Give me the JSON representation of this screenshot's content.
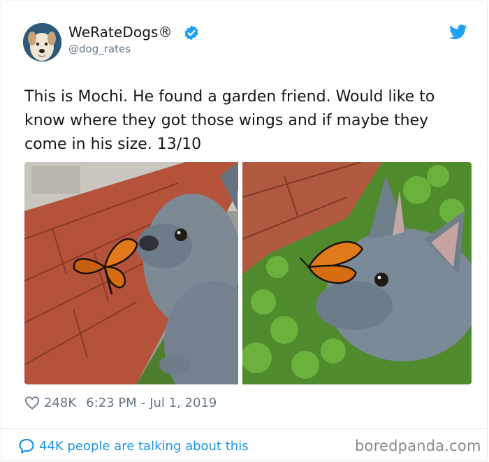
{
  "author": {
    "display_name": "WeRateDogs®",
    "handle": "@dog_rates",
    "verified": true
  },
  "tweet": {
    "text": "This is Mochi. He found a garden friend. Would like to know where they got those wings and if maybe they come in his size. 13/10",
    "likes": "248K",
    "time": "6:23 PM",
    "date_separator": "-",
    "date": "Jul 1, 2019"
  },
  "footer": {
    "talking_text": "44K people are talking about this",
    "watermark": "boredpanda.com"
  },
  "colors": {
    "link_blue": "#1b95e0",
    "verified_blue": "#1da1f2",
    "muted_gray": "#657786",
    "border": "#e1e8ed"
  },
  "icons": {
    "verified": "verified-badge-icon",
    "brand": "twitter-bird-icon",
    "like": "heart-icon",
    "reply": "speech-bubble-icon"
  }
}
